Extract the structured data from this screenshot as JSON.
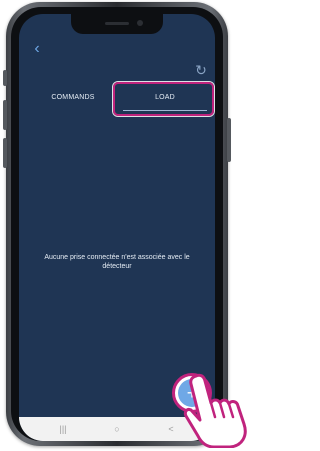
{
  "header": {
    "back_icon": "chevron-left-icon",
    "back_glyph": "‹",
    "refresh_icon": "refresh-icon",
    "refresh_glyph": "↻"
  },
  "tabs": [
    {
      "label": "COMMANDS",
      "selected": false
    },
    {
      "label": "LOAD",
      "selected": true
    }
  ],
  "main": {
    "empty_message": "Aucune prise connectée n'est associée avec le détecteur"
  },
  "fab": {
    "icon": "plus-icon",
    "glyph": "+"
  },
  "navbar": {
    "recent_glyph": "|||",
    "home_glyph": "○",
    "back_glyph": "<"
  },
  "colors": {
    "screen_background": "#1f3554",
    "accent": "#6fa8e6",
    "highlight": "#c0237d"
  }
}
